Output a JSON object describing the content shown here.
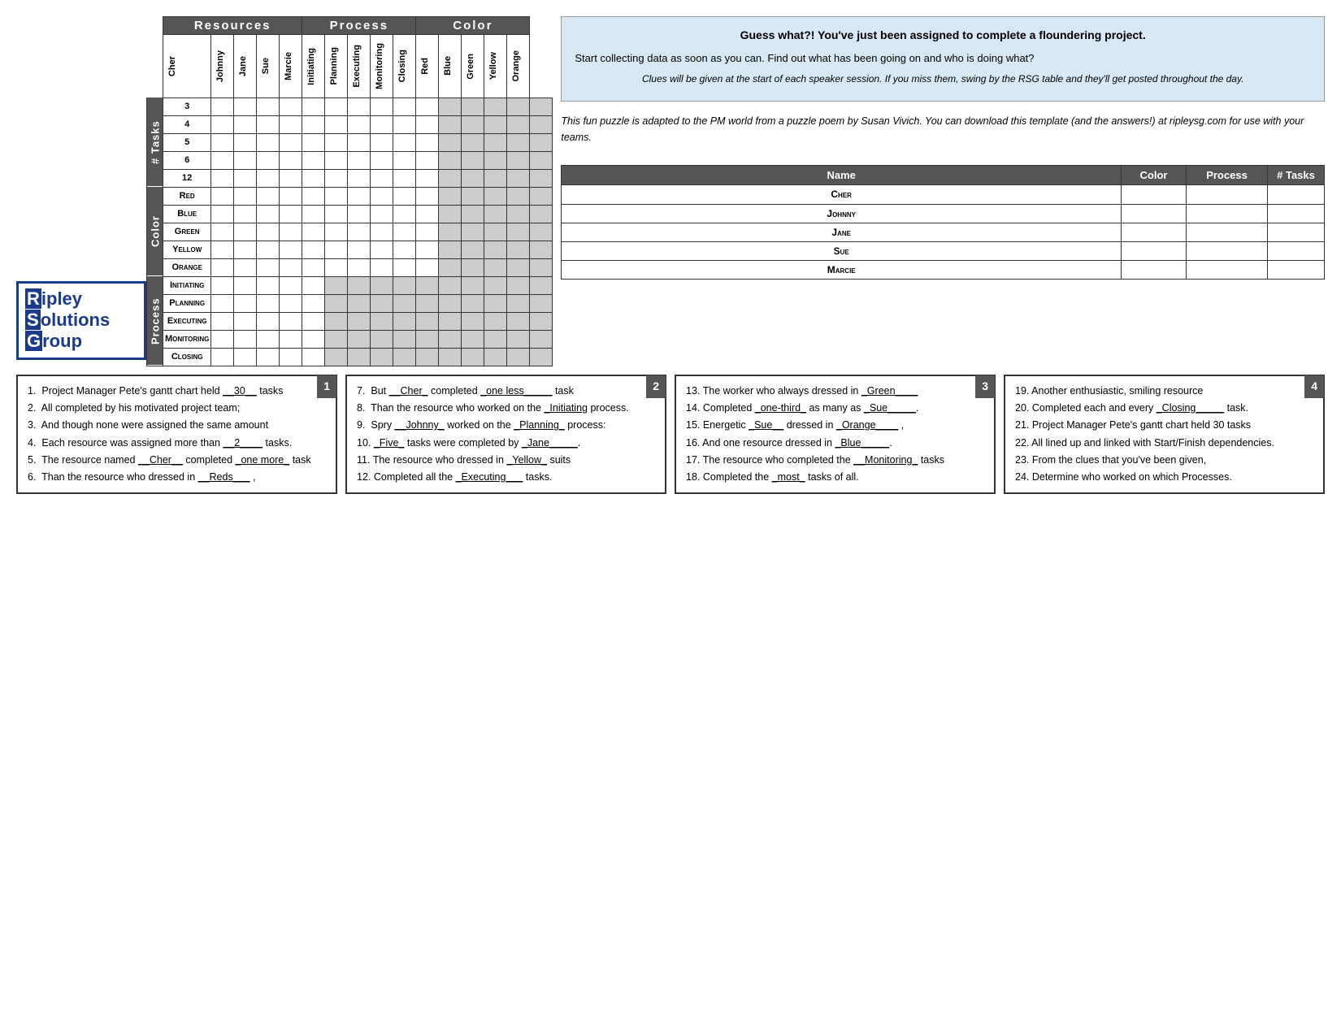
{
  "logo": {
    "line1": "Ripley",
    "line2": "Solutions",
    "line3": "Group",
    "r": "R",
    "s": "S",
    "g": "G"
  },
  "grid": {
    "resources_header": "Resources",
    "process_header": "Process",
    "color_header": "Color",
    "resource_cols": [
      "Cher",
      "Johnny",
      "Jane",
      "Sue",
      "Marcie"
    ],
    "process_cols": [
      "Initiating",
      "Planning",
      "Executing",
      "Monitoring",
      "Closing"
    ],
    "color_cols": [
      "Red",
      "Blue",
      "Green",
      "Yellow",
      "Orange"
    ],
    "row_groups": {
      "tasks_label": "# Tasks",
      "task_rows": [
        "3",
        "4",
        "5",
        "6",
        "12"
      ],
      "color_label": "Color",
      "color_rows": [
        "Red",
        "Blue",
        "Green",
        "Yellow",
        "Orange"
      ],
      "process_label": "Process",
      "process_rows": [
        "Initiating",
        "Planning",
        "Executing",
        "Monitoring",
        "Closing"
      ]
    }
  },
  "info_box": {
    "title": "Guess what?! You've just been assigned to complete a floundering project.",
    "para1": "Start collecting data as soon as you can.  Find out what has been going on and who is doing what?",
    "italic1": "Clues will be given at the start of each speaker session.  If you miss them, swing by the RSG table and they'll get posted throughout the day.",
    "italic2": "This fun puzzle is adapted to the PM world from a puzzle poem by Susan Vivich.  You can download this template (and the answers!) at ripleysg.com for use with your teams."
  },
  "summary_table": {
    "headers": [
      "Name",
      "Color",
      "Process",
      "# Tasks"
    ],
    "rows": [
      {
        "name": "Cher",
        "color": "",
        "process": "",
        "tasks": ""
      },
      {
        "name": "Johnny",
        "color": "",
        "process": "",
        "tasks": ""
      },
      {
        "name": "Jane",
        "color": "",
        "process": "",
        "tasks": ""
      },
      {
        "name": "Sue",
        "color": "",
        "process": "",
        "tasks": ""
      },
      {
        "name": "Marcie",
        "color": "",
        "process": "",
        "tasks": ""
      }
    ]
  },
  "clues": {
    "box1_number": "1",
    "box1_items": [
      "1.  Project Manager Pete’s gantt chart held <u>__30__</u> tasks",
      "2.  All completed by his motivated project team;",
      "3.  And though none were assigned the same amount",
      "4.  Each resource was assigned more than <u>__2____</u> tasks.",
      "5.  The resource named <u>__Cher__</u> completed <u>_one more_</u>task",
      "6.  Than the resource who dressed in <u>__Reds___</u> ,"
    ],
    "box2_number": "2",
    "box2_items": [
      "7.  But <u>__Cher_</u> completed <u>_one less_____</u> task",
      "8.  Than the resource who worked on the <u>_Initiating</u> process.",
      "9.  Spry <u>__Johnny_</u> worked on the <u>_Planning_</u> process:",
      "10. <u>_Five_</u> tasks were completed by <u>_Jane_____</u>.",
      "11. The resource who dressed in <u>_Yellow_</u> suits",
      "12. Completed all the <u>_Executing___</u> tasks."
    ],
    "box3_number": "3",
    "box3_items": [
      "13. The worker who always dressed in <u>_Green____</u>",
      "14. Completed <u>_one-third_</u> as many as <u>_Sue_____</u>.",
      "15. Energetic <u>_Sue__</u> dressed in <u>_Orange____</u> ,",
      "16. And one resource dressed in <u>_Blue_____</u>.",
      "17. The resource who completed the <u>__Monitoring_</u> tasks",
      "18. Completed the <u>_most_</u> tasks of all."
    ],
    "box4_number": "4",
    "box4_items": [
      "19. Another enthusiastic, smiling resource",
      "20. Completed each and every <u>_Closing_____</u> task.",
      "21. Project Manager Pete’s gantt chart held 30 tasks",
      "22. All lined up and linked with Start/Finish dependencies.",
      "23. From the clues that you’ve been given,",
      "24. Determine who worked on which Processes."
    ]
  }
}
